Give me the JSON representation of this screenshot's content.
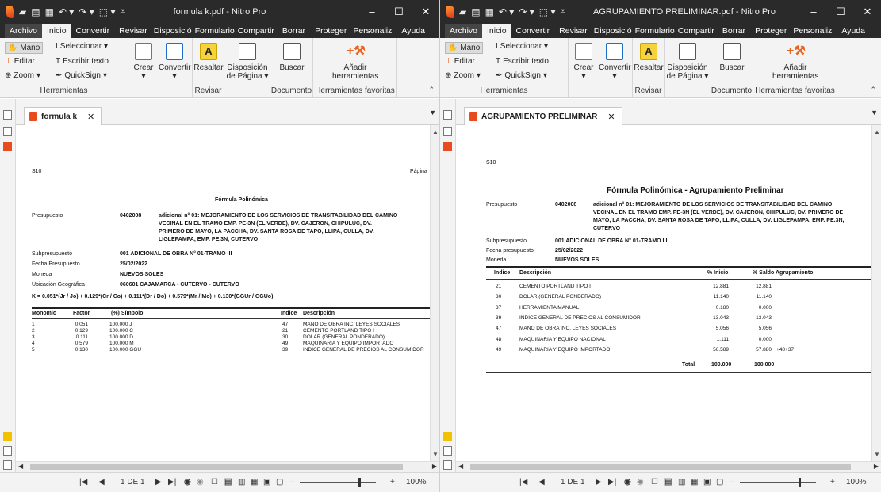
{
  "left": {
    "title": "formula k.pdf - Nitro Pro",
    "doc_tab": "formula k",
    "zoom": "100%",
    "page_indicator": "1 DE 1",
    "doc": {
      "s10": "S10",
      "pagina": "Página",
      "heading": "Fórmula Polinómica",
      "presupuesto_label": "Presupuesto",
      "presupuesto_code": "0402008",
      "presupuesto_desc": [
        "adicional n° 01: MEJORAMIENTO DE LOS SERVICIOS DE TRANSITABILIDAD DEL CAMINO",
        "VECINAL EN EL TRAMO EMP. PE-3N (EL VERDE), DV. CAJERON, CHIPULUC, DV.",
        "PRIMERO DE MAYO, LA PACCHA, DV. SANTA ROSA DE TAPO, LLIPA, CULLA, DV.",
        "LIGLEPAMPA, EMP. PE.3N, CUTERVO"
      ],
      "subpresupuesto_label": "Subpresupuesto",
      "subpresupuesto_value": "001  ADICIONAL DE OBRA N° 01-TRAMO III",
      "fecha_label": "Fecha Presupuesto",
      "fecha_value": "25/02/2022",
      "moneda_label": "Moneda",
      "moneda_value": "NUEVOS SOLES",
      "ubicacion_label": "Ubicación Geográfica",
      "ubicacion_value": "060601    CAJAMARCA  - CUTERVO - CUTERVO",
      "formula": "K =   0.051*(Jr / Jo) + 0.129*(Cr / Co) + 0.111*(Dr / Do) + 0.579*(Mr / Mo) + 0.130*(GGUr / GGUo)",
      "columns": [
        "Monomio",
        "Factor",
        "(%)  Símbolo",
        "Indice",
        "Descripción"
      ],
      "rows": [
        [
          "1",
          "0.051",
          "100.000 J",
          "47",
          "MANO DE OBRA INC. LEYES SOCIALES"
        ],
        [
          "2",
          "0.129",
          "100.000 C",
          "21",
          "CEMENTO PORTLAND TIPO I"
        ],
        [
          "3",
          "0.111",
          "100.000 D",
          "30",
          "DOLAR (GENERAL PONDERADO)"
        ],
        [
          "4",
          "0.579",
          "100.000 M",
          "49",
          "MAQUINARIA Y EQUIPO IMPORTADO"
        ],
        [
          "5",
          "0.130",
          "100.000 GGU",
          "39",
          "INDICE GENERAL DE PRECIOS AL CONSUMIDOR"
        ]
      ]
    }
  },
  "right": {
    "title": "AGRUPAMIENTO PRELIMINAR.pdf - Nitro Pro",
    "doc_tab": "AGRUPAMIENTO PRELIMINAR",
    "zoom": "100%",
    "page_indicator": "1 DE 1",
    "doc": {
      "s10": "S10",
      "heading": "Fórmula Polinómica - Agrupamiento Preliminar",
      "presupuesto_label": "Presupuesto",
      "presupuesto_code": "0402008",
      "presupuesto_desc": [
        "adicional n° 01: MEJORAMIENTO DE LOS SERVICIOS DE TRANSITABILIDAD DEL CAMINO",
        "VECINAL EN EL TRAMO EMP. PE-3N (EL VERDE), DV. CAJERON, CHIPULUC, DV. PRIMERO DE",
        "MAYO, LA PACCHA, DV. SANTA ROSA DE TAPO, LLIPA, CULLA, DV. LIGLEPAMPA, EMP. PE.3N,",
        "CUTERVO"
      ],
      "subpresupuesto_label": "Subpresupuesto",
      "subpresupuesto_value": "001  ADICIONAL DE OBRA N° 01-TRAMO III",
      "fecha_label": "Fecha presupuesto",
      "fecha_value": "25/02/2022",
      "moneda_label": "Moneda",
      "moneda_value": "NUEVOS SOLES",
      "columns": [
        "Indice",
        "Descripción",
        "% Inicio",
        "% Saldo",
        "Agrupamiento"
      ],
      "rows": [
        [
          "21",
          "CEMENTO PORTLAND TIPO I",
          "12.881",
          "12.881",
          ""
        ],
        [
          "30",
          "DOLAR (GENERAL PONDERADO)",
          "11.140",
          "11.140",
          ""
        ],
        [
          "37",
          "HERRAMIENTA MANUAL",
          "0.180",
          "0.000",
          ""
        ],
        [
          "39",
          "INDICE GENERAL DE PRECIOS AL CONSUMIDOR",
          "13.043",
          "13.043",
          ""
        ],
        [
          "47",
          "MANO DE OBRA INC. LEYES SOCIALES",
          "5.056",
          "5.056",
          ""
        ],
        [
          "48",
          "MAQUINARIA Y EQUIPO NACIONAL",
          "1.111",
          "0.000",
          ""
        ],
        [
          "49",
          "MAQUINARIA Y EQUIPO IMPORTADO",
          "56.589",
          "57.880",
          "+48+37"
        ]
      ],
      "total_label": "Total",
      "total_inicio": "100.000",
      "total_saldo": "100.000"
    }
  },
  "menu": [
    "Archivo",
    "Inicio",
    "Convertir",
    "Revisar",
    "Disposició",
    "Formulario",
    "Compartir",
    "Borrar",
    "Proteger",
    "Personaliz",
    "Ayuda"
  ],
  "ribbon": {
    "mano": "Mano",
    "editar": "Editar",
    "zoom": "Zoom",
    "seleccionar": "Seleccionar",
    "escribir": "Escribir texto",
    "quicksign": "QuickSign",
    "herramientas": "Herramientas",
    "crear": "Crear",
    "convertir": "Convertir",
    "resaltar": "Resaltar",
    "disposicion": "Disposición de Página",
    "buscar": "Buscar",
    "anadir": "Añadir herramientas",
    "revisar": "Revisar",
    "documento": "Documento",
    "favoritas": "Herramientas favoritas"
  },
  "colors": {
    "titlebar": "#2a2a2a",
    "ribbon": "#f3f3f3",
    "pdf_orange": "#e84c1e",
    "accent_yellow": "#f2c200"
  }
}
